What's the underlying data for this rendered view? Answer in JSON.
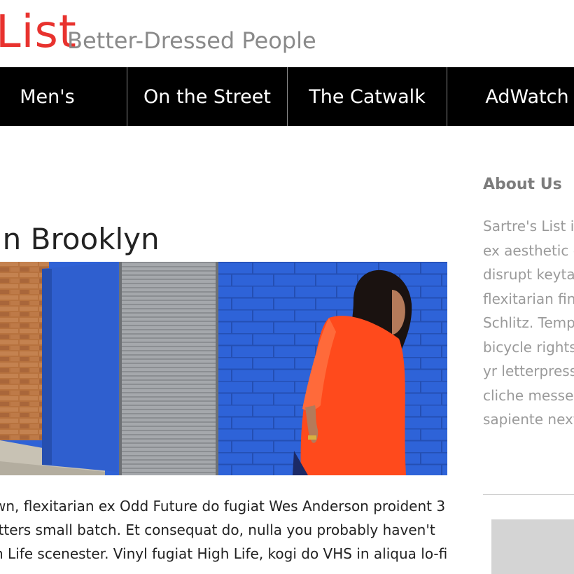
{
  "header": {
    "logo_text": "List",
    "tagline": "Better-Dressed People"
  },
  "nav": {
    "items": [
      "Men's",
      "On the Street",
      "The Catwalk",
      "AdWatch"
    ]
  },
  "article": {
    "title": "in Brooklyn",
    "lines": [
      "wn, flexitarian ex Odd Future do fugiat Wes Anderson proident 3",
      "itters small batch. Et consequat do, nulla you probably haven't",
      "n Life scenester. Vinyl fugiat High Life, kogi do VHS in aliqua lo-fi"
    ]
  },
  "sidebar": {
    "title": "About Us",
    "lines": [
      "Sartre's List is",
      "ex aesthetic q",
      "disrupt keytar",
      "flexitarian fing",
      "Schlitz. Tempo",
      "bicycle rights.",
      "yr letterpress",
      "cliche messen",
      "sapiente next"
    ]
  },
  "colors": {
    "brand_red": "#e8322e",
    "nav_bg": "#000000",
    "wall_blue": "#2f62d6",
    "dress_orange": "#ff4a1c"
  }
}
